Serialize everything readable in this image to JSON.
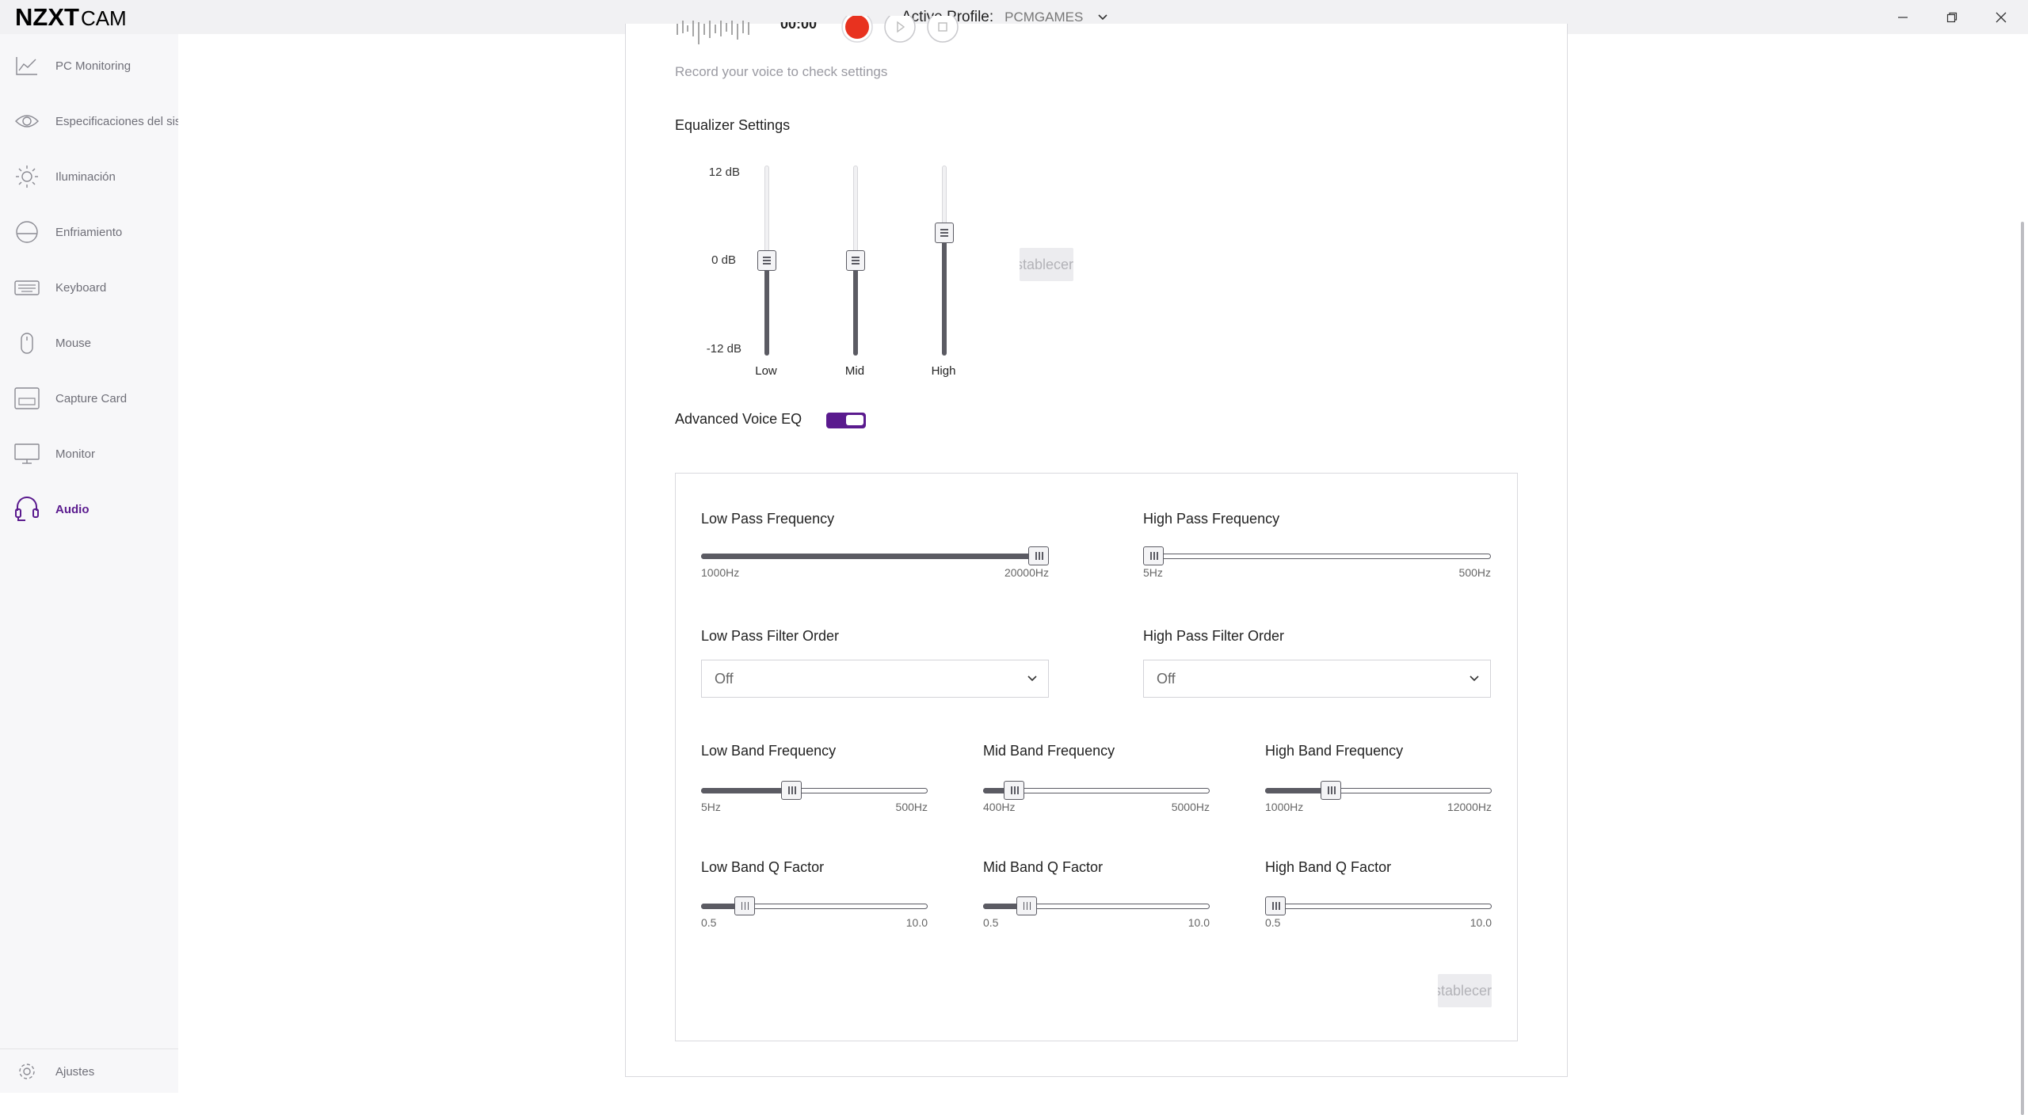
{
  "app": {
    "logo_main": "NZXT",
    "logo_sub": "CAM",
    "active_profile_label": "Active Profile:",
    "active_profile_value": "PCMGAMES"
  },
  "window_controls": [
    "minimize",
    "restore",
    "close"
  ],
  "sidebar": {
    "items": [
      {
        "label": "PC Monitoring",
        "icon": "chart-line-icon"
      },
      {
        "label": "Especificaciones del sistema",
        "icon": "eye-icon"
      },
      {
        "label": "Iluminación",
        "icon": "sun-icon"
      },
      {
        "label": "Enfriamiento",
        "icon": "cooling-icon"
      },
      {
        "label": "Keyboard",
        "icon": "keyboard-icon"
      },
      {
        "label": "Mouse",
        "icon": "mouse-icon"
      },
      {
        "label": "Capture Card",
        "icon": "capture-card-icon"
      },
      {
        "label": "Monitor",
        "icon": "monitor-icon"
      },
      {
        "label": "Audio",
        "icon": "headset-icon",
        "active": true
      }
    ],
    "footer": {
      "label": "Ajustes",
      "icon": "gear-icon"
    }
  },
  "recorder": {
    "time": "00:00",
    "hint": "Record your voice to check settings"
  },
  "equalizer": {
    "title": "Equalizer Settings",
    "db_max": "12 dB",
    "db_mid": "0 dB",
    "db_min": "-12 dB",
    "bands": [
      {
        "label": "Low",
        "value_db": 0
      },
      {
        "label": "Mid",
        "value_db": 0
      },
      {
        "label": "High",
        "value_db": 3.5
      }
    ],
    "reset_label": "Restablecer"
  },
  "advanced": {
    "label": "Advanced Voice EQ",
    "enabled": true,
    "low_pass": {
      "title": "Low Pass Frequency",
      "min": "1000Hz",
      "max": "20000Hz",
      "fraction": 1.0
    },
    "high_pass": {
      "title": "High Pass Frequency",
      "min": "5Hz",
      "max": "500Hz",
      "fraction": 0.0
    },
    "low_pass_order": {
      "title": "Low Pass Filter Order",
      "value": "Off"
    },
    "high_pass_order": {
      "title": "High Pass Filter Order",
      "value": "Off"
    },
    "low_band": {
      "title": "Low Band Frequency",
      "min": "5Hz",
      "max": "500Hz",
      "fraction": 0.39
    },
    "mid_band": {
      "title": "Mid Band Frequency",
      "min": "400Hz",
      "max": "5000Hz",
      "fraction": 0.1
    },
    "high_band": {
      "title": "High Band Frequency",
      "min": "1000Hz",
      "max": "12000Hz",
      "fraction": 0.27
    },
    "low_q": {
      "title": "Low Band Q Factor",
      "min": "0.5",
      "max": "10.0",
      "fraction": 0.16
    },
    "mid_q": {
      "title": "Mid Band Q Factor",
      "min": "0.5",
      "max": "10.0",
      "fraction": 0.16
    },
    "high_q": {
      "title": "High Band Q Factor",
      "min": "0.5",
      "max": "10.0",
      "fraction": 0.0
    },
    "reset_label": "Restablecer"
  }
}
